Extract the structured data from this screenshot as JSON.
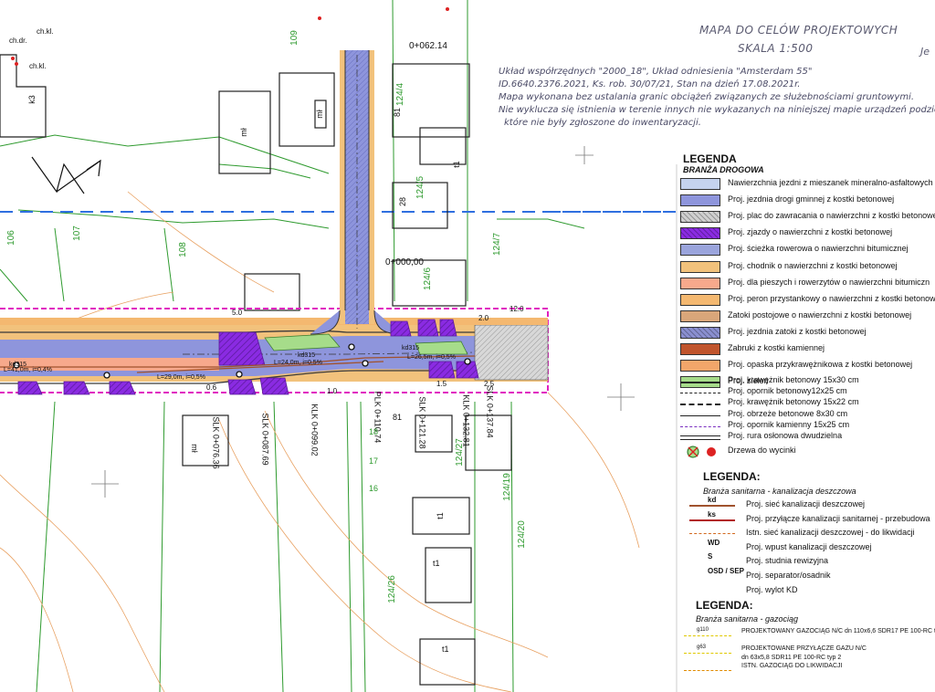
{
  "header": {
    "title_line1": "MAPA DO CELÓW PROJEKTOWYCH",
    "title_line2": "SKALA 1:500",
    "title_cut": "Je"
  },
  "info_lines": [
    "Układ współrzędnych \"2000_18\", Układ odniesienia \"Amsterdam 55\"",
    "ID.6640.2376.2021, Ks. rob. 30/07/21, Stan na dzień 17.08.2021r.",
    "Mapa wykonana bez ustalania granic obciążeń związanych ze służebnościami gruntowymi.",
    "Nie wyklucza się istnienia w terenie innych nie wykazanych na niniejszej mapie urządzeń podziem",
    "które nie były zgłoszone do inwentaryzacji."
  ],
  "legend_road": {
    "heading": "LEGENDA",
    "subheading": "BRANŻA DROGOWA",
    "fills": [
      {
        "label": "Nawierzchnia jezdni z mieszanek mineralno-asfaltowych",
        "color": "#c5d3ef",
        "pattern": "plain"
      },
      {
        "label": "Proj. jezdnia drogi gminnej z kostki betonowej",
        "color": "#8e95dc",
        "pattern": "plain"
      },
      {
        "label": "Proj. plac do zawracania o nawierzchni z kostki betonowej",
        "color": "#cfcfcf",
        "pattern": "hatch"
      },
      {
        "label": "Proj. zjazdy o nawierzchni z kostki betonowej",
        "color": "#8a2be2",
        "pattern": "hatch"
      },
      {
        "label": "Proj. ścieżka rowerowa o nawierzchni bitumicznej",
        "color": "#9aa4dc",
        "pattern": "plain"
      },
      {
        "label": "Proj. chodnik o nawierzchni z kostki betonowej",
        "color": "#f2c27c",
        "pattern": "plain"
      },
      {
        "label": "Proj. dla pieszych i rowerzytów o nawierzchni bitumiczn",
        "color": "#f7a98c",
        "pattern": "plain"
      },
      {
        "label": "Proj. peron przystankowy o nawierzchni z kostki betonowej",
        "color": "#f4b870",
        "pattern": "plain"
      },
      {
        "label": "Zatoki postojowe o nawierzchni z kostki betonowej",
        "color": "#d9a67a",
        "pattern": "plain"
      },
      {
        "label": "Proj. jezdnia zatoki z kostki betonowej",
        "color": "#8a8fd0",
        "pattern": "hatch"
      },
      {
        "label": "Zabruki z kostki kamiennej",
        "color": "#c0542c",
        "pattern": "plain"
      },
      {
        "label": "Proj. opaska przykrawężnikowa z kostki betonowej",
        "color": "#f2a66a",
        "pattern": "plain"
      },
      {
        "label": "Proj. zieleń",
        "color": "#a6dc8a",
        "pattern": "plain"
      }
    ],
    "lines": [
      {
        "label": "Proj. krawężnik betonowy 15x30 cm",
        "color": "#222222",
        "style": "solid"
      },
      {
        "label": "Proj. opornik betonowy12x25 cm",
        "color": "#222222",
        "style": "dashdot"
      },
      {
        "label": "Proj. krawężnik betonowy 15x22 cm",
        "color": "#222222",
        "style": "dashed"
      },
      {
        "label": "Proj. obrzeże betonowe 8x30 cm",
        "color": "#222222",
        "style": "thin"
      },
      {
        "label": "Proj. opornik kamienny 15x25 cm",
        "color": "#7b2fc0",
        "style": "dashdot"
      },
      {
        "label": "Proj. rura osłonowa dwudzielna",
        "color": "#222222",
        "style": "double"
      }
    ],
    "trees_label": "Drzewa do wycinki"
  },
  "legend_sanitary": {
    "heading": "LEGENDA:",
    "subheading": "Branża sanitarna - kanalizacja deszczowa",
    "items": [
      {
        "symbol": "kd",
        "label": "Proj. sieć kanalizacji deszczowej",
        "color": "#a0522d"
      },
      {
        "symbol": "ks",
        "label": "Proj. przyłącze kanalizacji sanitarnej - przebudowa",
        "color": "#b22222"
      },
      {
        "symbol": "",
        "label": "Istn. sieć kanalizacji deszczowej - do likwidacji",
        "color": "#d2691e"
      },
      {
        "symbol": "WD",
        "label": "Proj. wpust kanalizacji deszczowej",
        "color": "#111111"
      },
      {
        "symbol": "S",
        "label": "Proj. studnia rewizyjna",
        "color": "#111111"
      },
      {
        "symbol": "OSD / SEP",
        "label": "Proj. separator/osadnik",
        "color": "#111111"
      },
      {
        "symbol": "",
        "label": "Proj. wylot KD",
        "color": "#111111"
      }
    ]
  },
  "legend_gas": {
    "heading": "LEGENDA:",
    "subheading": "Branża sanitarna - gazociąg",
    "items": [
      {
        "symbol": "g110",
        "label": "PROJEKTOWANY GAZOCIĄG N/C dn 110x6,6 SDR17 PE 100-RC typ",
        "color": "#e0c800"
      },
      {
        "symbol": "g63",
        "label": "PROJEKTOWANE PRZYŁĄCZE GAZU N/C",
        "label2": "dn 63x5,8 SDR11 PE 100-RC typ 2",
        "color": "#e0c800"
      },
      {
        "symbol": "",
        "label": "ISTN. GAZOCIĄG DO LIKWIDACJI",
        "color": "#e08a00"
      }
    ]
  },
  "map_labels": {
    "station_top": "0+062.14",
    "station_mid": "0+000,00",
    "parcels": [
      "124/4",
      "124/5",
      "124/6",
      "124/7",
      "124/19",
      "124/20",
      "124/26",
      "124/27",
      "106",
      "107",
      "108",
      "109"
    ],
    "chainages": [
      "SLK 0+076.36",
      "SLK 0+087.69",
      "KLK 0+099.02",
      "PLK 0+110.74",
      "SLK 0+121.28",
      "KLK 0+132.81",
      "SLK 0+137.84"
    ],
    "dims": [
      "12.0",
      "2.0",
      "1.0",
      "2.5",
      "5.0",
      "1.5",
      "0.6"
    ],
    "buildings": [
      "k3",
      "mł",
      "mł",
      "mł",
      "t1",
      "t1",
      "t1",
      "t1",
      "ch.kl.",
      "ch.kl.",
      "ch.dr."
    ],
    "slopes": [
      "L=41,0m, i=0,4%",
      "L=24,0m, i=0,5%",
      "L=26,5m, i=0,5%",
      "L=29,0m, i=0,5%"
    ],
    "grid_x": [
      "kd315",
      "kd315",
      "kd315"
    ],
    "small": [
      "18",
      "17",
      "16",
      "81",
      "28",
      "81"
    ]
  }
}
